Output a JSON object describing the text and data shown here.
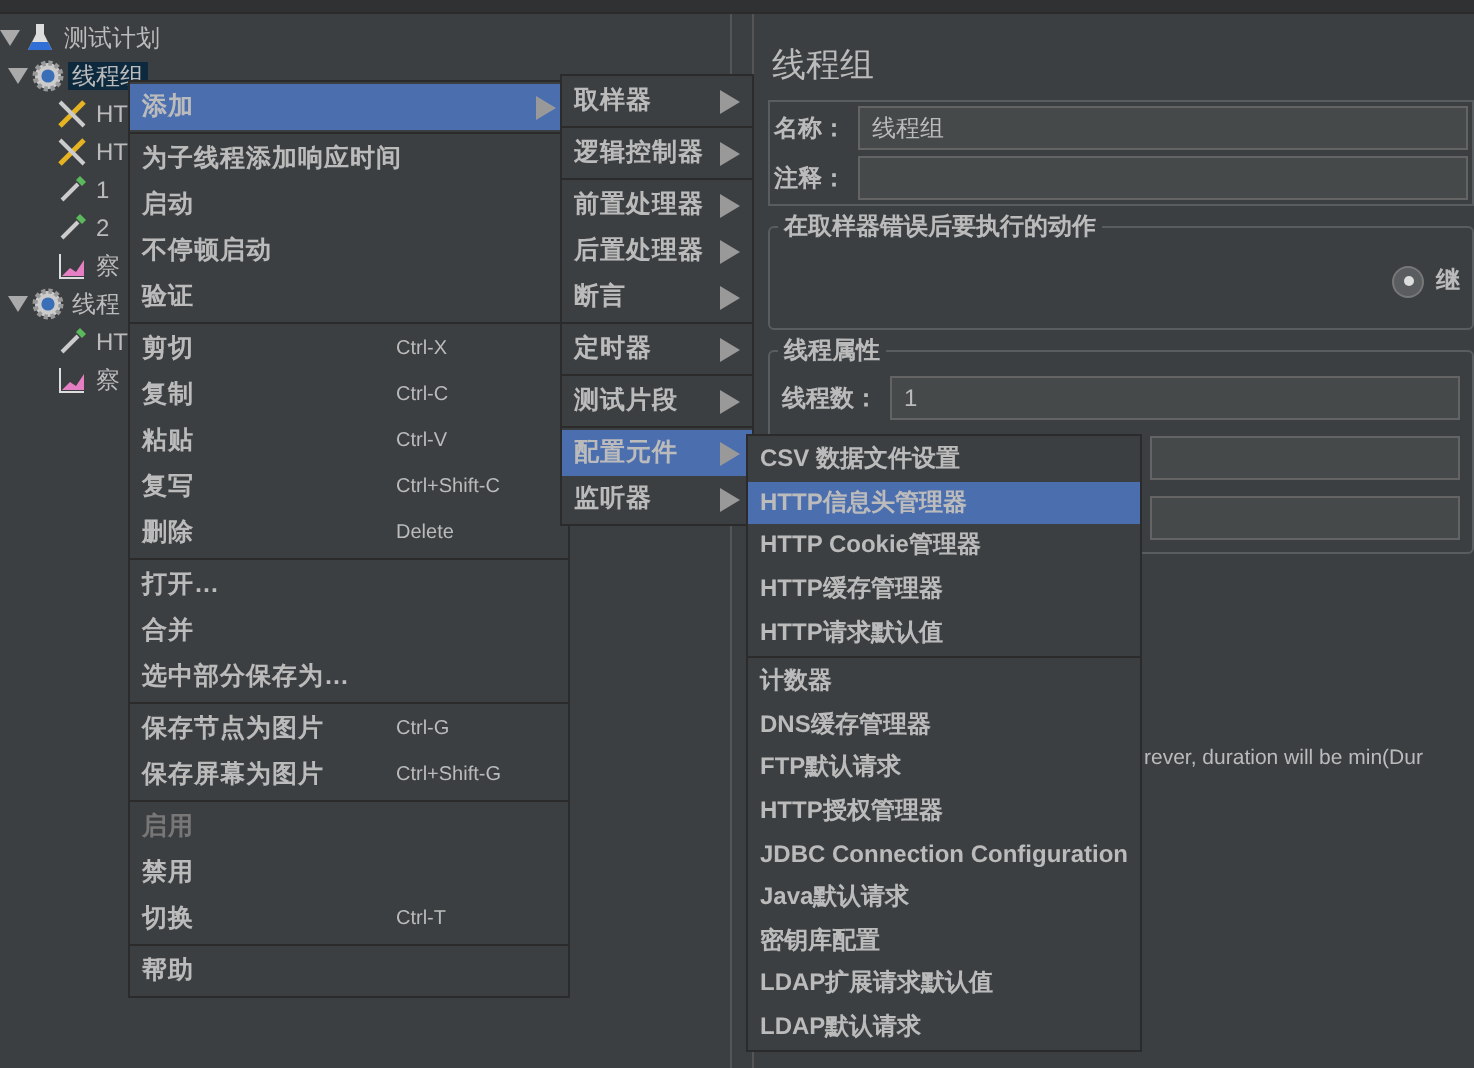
{
  "tree": [
    {
      "label": "测试计划",
      "kind": "plan",
      "expanded": true,
      "selected": false,
      "children": [
        {
          "label": "线程组",
          "kind": "group",
          "expanded": true,
          "selected": true,
          "children": [
            {
              "label": "HT",
              "kind": "tools",
              "selected": false
            },
            {
              "label": "HT",
              "kind": "tools",
              "selected": false
            },
            {
              "label": "1",
              "kind": "pipette",
              "selected": false
            },
            {
              "label": "2",
              "kind": "pipette",
              "selected": false
            },
            {
              "label": "察",
              "kind": "chart",
              "selected": false
            }
          ]
        },
        {
          "label": "线程",
          "kind": "group",
          "expanded": true,
          "selected": false,
          "children": [
            {
              "label": "HT",
              "kind": "pipette",
              "selected": false
            },
            {
              "label": "察",
              "kind": "chart",
              "selected": false
            }
          ]
        }
      ]
    }
  ],
  "panel": {
    "title": "线程组",
    "name_label": "名称：",
    "name_value": "线程组",
    "comment_label": "注释：",
    "error_group": {
      "legend": "在取样器错误后要执行的动作",
      "option": {
        "label": "继",
        "selected": true
      }
    },
    "thread_group": {
      "legend": "线程属性",
      "threads_label": "线程数：",
      "threads_value": "1"
    },
    "note": "rever, duration will be min(Dur"
  },
  "context_menu": [
    [
      {
        "label": "添加",
        "submenu": true,
        "selected": true
      }
    ],
    [
      {
        "label": "为子线程添加响应时间"
      },
      {
        "label": "启动"
      },
      {
        "label": "不停顿启动"
      },
      {
        "label": "验证"
      }
    ],
    [
      {
        "label": "剪切",
        "shortcut": "Ctrl-X"
      },
      {
        "label": "复制",
        "shortcut": "Ctrl-C"
      },
      {
        "label": "粘贴",
        "shortcut": "Ctrl-V"
      },
      {
        "label": "复写",
        "shortcut": "Ctrl+Shift-C"
      },
      {
        "label": "删除",
        "shortcut": "Delete"
      }
    ],
    [
      {
        "label": "打开…"
      },
      {
        "label": "合并"
      },
      {
        "label": "选中部分保存为…"
      }
    ],
    [
      {
        "label": "保存节点为图片",
        "shortcut": "Ctrl-G"
      },
      {
        "label": "保存屏幕为图片",
        "shortcut": "Ctrl+Shift-G"
      }
    ],
    [
      {
        "label": "启用",
        "disabled": true
      },
      {
        "label": "禁用",
        "disabled": false
      },
      {
        "label": "切换",
        "shortcut": "Ctrl-T",
        "disabled": false
      }
    ],
    [
      {
        "label": "帮助"
      }
    ]
  ],
  "add_menu": [
    [
      {
        "label": "取样器",
        "submenu": true,
        "selected": false
      }
    ],
    [
      {
        "label": "逻辑控制器",
        "submenu": true,
        "selected": false
      }
    ],
    [
      {
        "label": "前置处理器",
        "submenu": true,
        "selected": false
      },
      {
        "label": "后置处理器",
        "submenu": true,
        "selected": false
      },
      {
        "label": "断言",
        "submenu": true,
        "selected": false
      }
    ],
    [
      {
        "label": "定时器",
        "submenu": true,
        "selected": false
      }
    ],
    [
      {
        "label": "测试片段",
        "submenu": true,
        "selected": false
      }
    ],
    [
      {
        "label": "配置元件",
        "submenu": true,
        "selected": true
      },
      {
        "label": "监听器",
        "submenu": true,
        "selected": false
      }
    ]
  ],
  "config_menu": [
    [
      {
        "label": "CSV 数据文件设置",
        "selected": false
      },
      {
        "label": "HTTP信息头管理器",
        "selected": true
      },
      {
        "label": "HTTP Cookie管理器",
        "selected": false
      },
      {
        "label": "HTTP缓存管理器",
        "selected": false
      },
      {
        "label": "HTTP请求默认值",
        "selected": false
      }
    ],
    [
      {
        "label": "计数器",
        "selected": false
      },
      {
        "label": "DNS缓存管理器",
        "selected": false
      },
      {
        "label": "FTP默认请求",
        "selected": false
      },
      {
        "label": "HTTP授权管理器",
        "selected": false
      },
      {
        "label": "JDBC Connection Configuration",
        "selected": false
      },
      {
        "label": "Java默认请求",
        "selected": false
      },
      {
        "label": "密钥库配置",
        "selected": false
      },
      {
        "label": "LDAP扩展请求默认值",
        "selected": false
      },
      {
        "label": "LDAP默认请求",
        "selected": false
      }
    ]
  ]
}
